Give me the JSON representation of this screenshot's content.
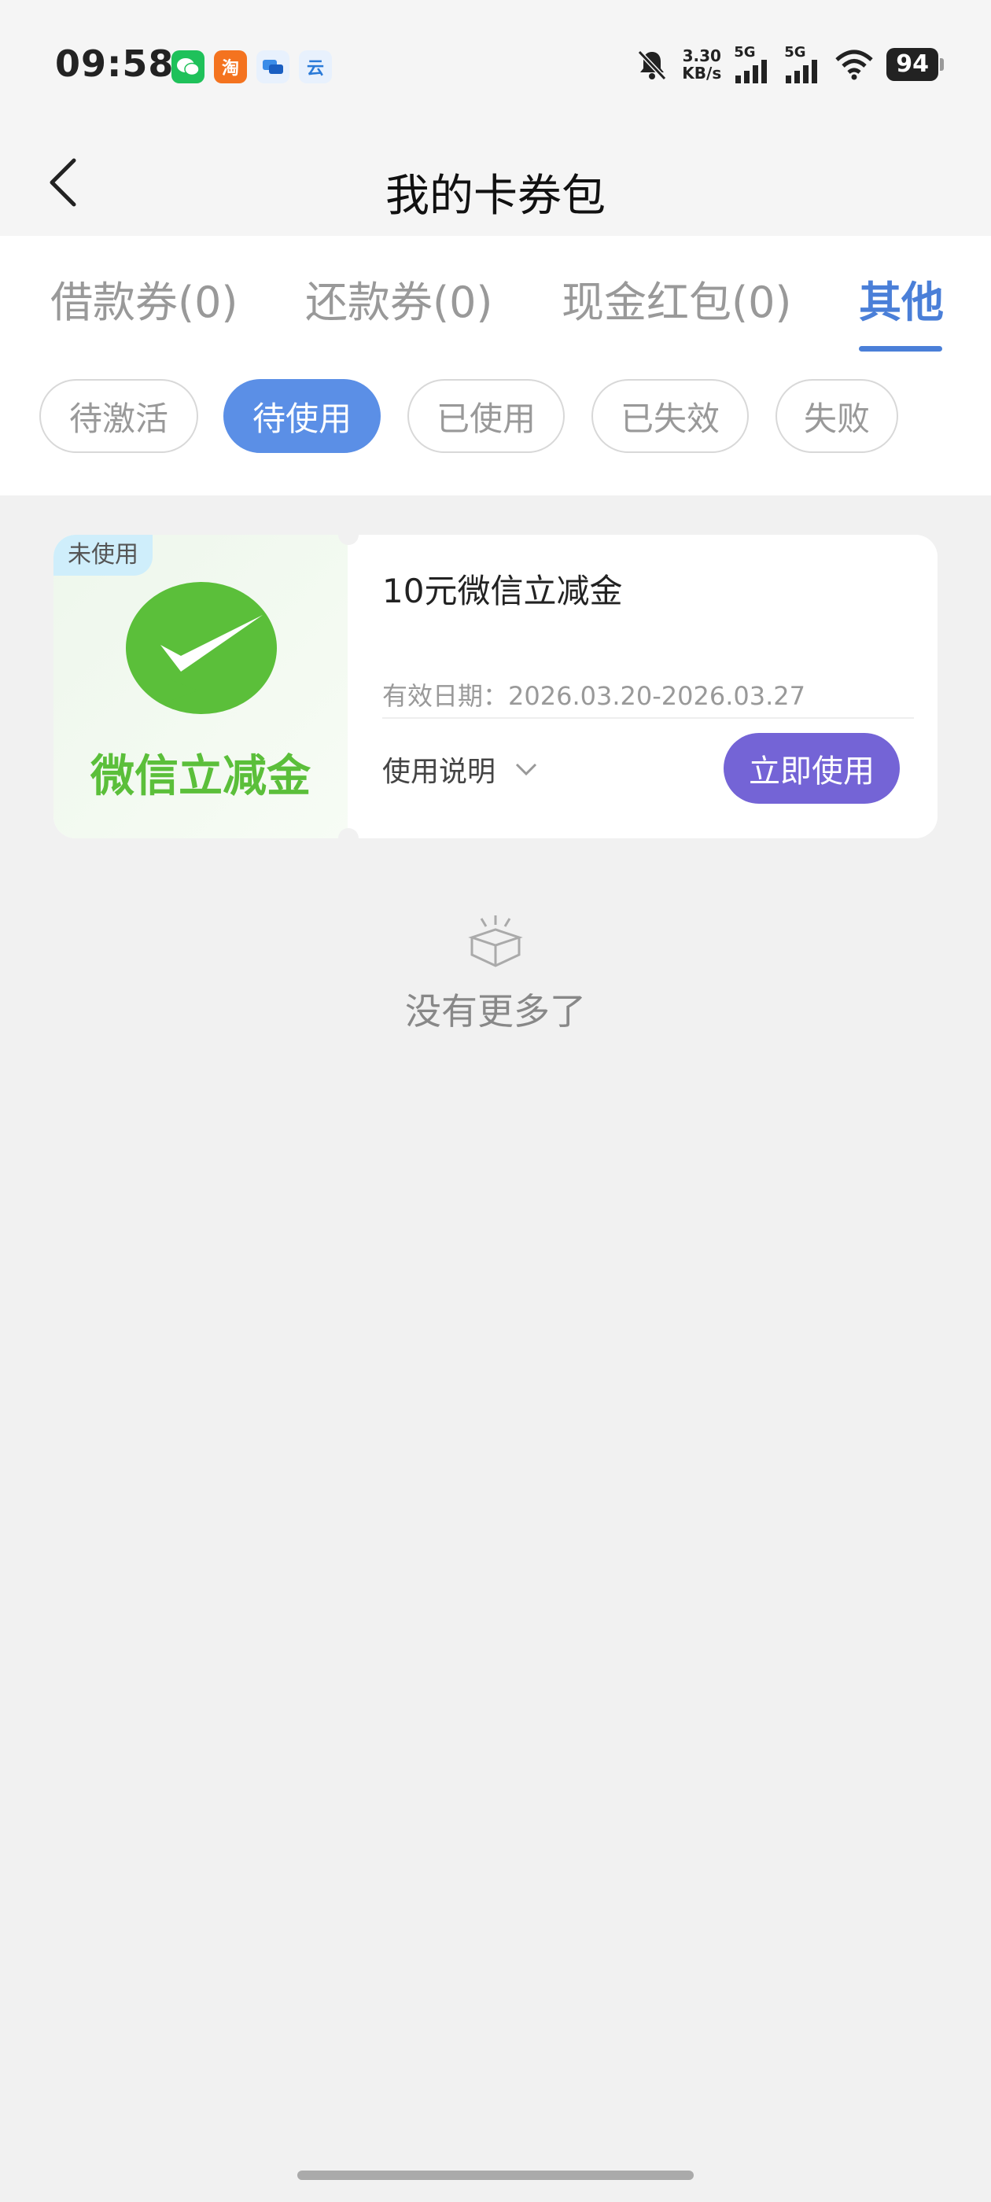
{
  "status_bar": {
    "time": "09:58",
    "app_icons": [
      {
        "name": "wechat-icon",
        "glyph": "",
        "color": "#1fc15a"
      },
      {
        "name": "taobao-icon",
        "glyph": "淘",
        "color": "#f4731f"
      },
      {
        "name": "message-icon",
        "glyph": "",
        "color": "#3a8ce8"
      },
      {
        "name": "cloud-app-icon",
        "glyph": "云",
        "color": "#2a7ad8"
      }
    ],
    "net_speed_value": "3.30",
    "net_speed_unit": "KB/s",
    "signal1_label": "5G",
    "signal2_label": "5G",
    "battery": "94"
  },
  "nav": {
    "title": "我的卡券包"
  },
  "tabs": [
    {
      "label": "借款券(0)",
      "active": false
    },
    {
      "label": "还款券(0)",
      "active": false
    },
    {
      "label": "现金红包(0)",
      "active": false
    },
    {
      "label": "其他",
      "active": true
    }
  ],
  "filters": [
    {
      "label": "待激活",
      "active": false
    },
    {
      "label": "待使用",
      "active": true
    },
    {
      "label": "已使用",
      "active": false
    },
    {
      "label": "已失效",
      "active": false
    },
    {
      "label": "失败",
      "active": false
    }
  ],
  "coupon": {
    "status_tag": "未使用",
    "brand_text": "微信立减金",
    "name": "10元微信立减金",
    "valid_date": "有效日期：2026.03.20-2026.03.27",
    "usage_label": "使用说明",
    "use_button": "立即使用"
  },
  "empty": {
    "text": "没有更多了"
  },
  "colors": {
    "accent_blue": "#4a7fd8",
    "active_chip": "#5b8fe6",
    "use_button": "#7464d6",
    "wechat_green": "#5bbf3a"
  }
}
